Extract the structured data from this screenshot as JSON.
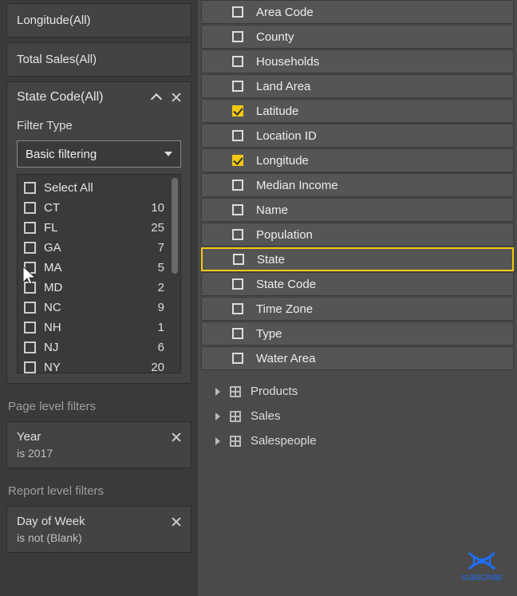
{
  "filters": {
    "longitude": {
      "title": "Longitude(All)"
    },
    "total_sales": {
      "title": "Total Sales(All)"
    },
    "state_code": {
      "title": "State Code(All)",
      "filter_type_label": "Filter Type",
      "dropdown_value": "Basic filtering",
      "select_all_label": "Select All",
      "items": [
        {
          "label": "CT",
          "count": "10"
        },
        {
          "label": "FL",
          "count": "25"
        },
        {
          "label": "GA",
          "count": "7"
        },
        {
          "label": "MA",
          "count": "5"
        },
        {
          "label": "MD",
          "count": "2"
        },
        {
          "label": "NC",
          "count": "9"
        },
        {
          "label": "NH",
          "count": "1"
        },
        {
          "label": "NJ",
          "count": "6"
        },
        {
          "label": "NY",
          "count": "20"
        }
      ]
    },
    "page_level_title": "Page level filters",
    "page_level_filter": {
      "name": "Year",
      "condition": "is 2017"
    },
    "report_level_title": "Report level filters",
    "report_level_filter": {
      "name": "Day of Week",
      "condition": "is not (Blank)"
    }
  },
  "fields": [
    {
      "label": "Area Code",
      "checked": false,
      "highlight": false
    },
    {
      "label": "County",
      "checked": false,
      "highlight": false
    },
    {
      "label": "Households",
      "checked": false,
      "highlight": false
    },
    {
      "label": "Land Area",
      "checked": false,
      "highlight": false
    },
    {
      "label": "Latitude",
      "checked": true,
      "highlight": false
    },
    {
      "label": "Location ID",
      "checked": false,
      "highlight": false
    },
    {
      "label": "Longitude",
      "checked": true,
      "highlight": false
    },
    {
      "label": "Median Income",
      "checked": false,
      "highlight": false
    },
    {
      "label": "Name",
      "checked": false,
      "highlight": false
    },
    {
      "label": "Population",
      "checked": false,
      "highlight": false
    },
    {
      "label": "State",
      "checked": false,
      "highlight": true
    },
    {
      "label": "State Code",
      "checked": false,
      "highlight": false
    },
    {
      "label": "Time Zone",
      "checked": false,
      "highlight": false
    },
    {
      "label": "Type",
      "checked": false,
      "highlight": false
    },
    {
      "label": "Water Area",
      "checked": false,
      "highlight": false
    }
  ],
  "tables": [
    {
      "label": "Products"
    },
    {
      "label": "Sales"
    },
    {
      "label": "Salespeople"
    }
  ],
  "subscribe_label": "SUBSCRIBE"
}
